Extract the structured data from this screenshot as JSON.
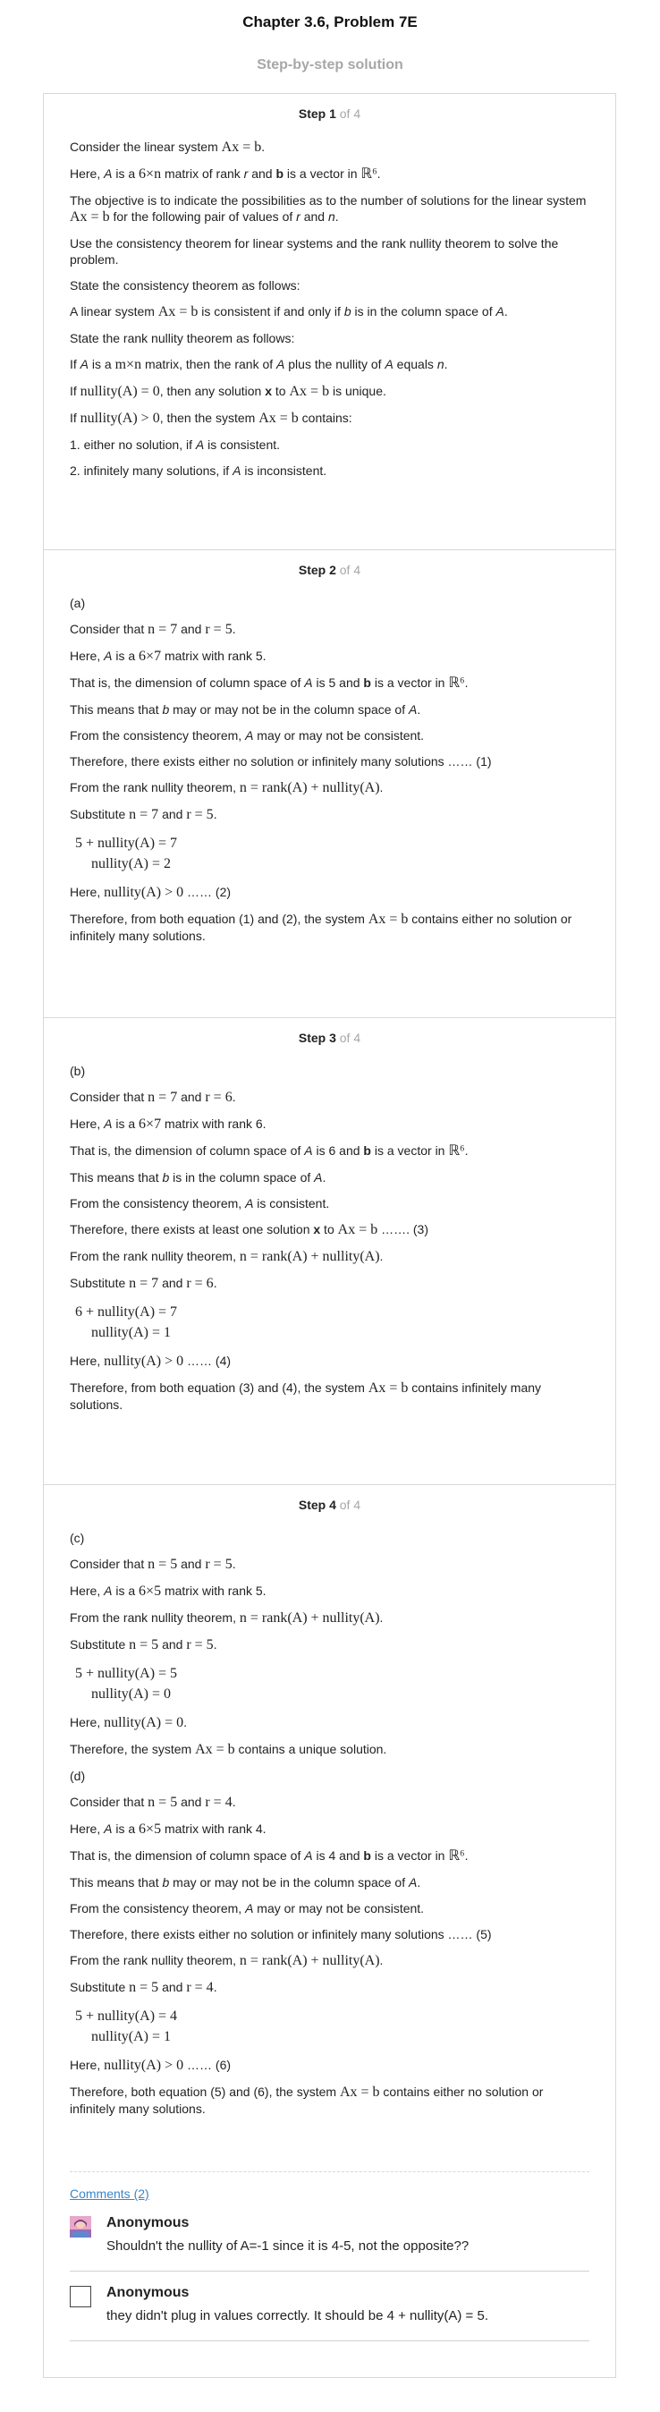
{
  "header": {
    "title": "Chapter 3.6, Problem 7E",
    "subtitle": "Step-by-step solution"
  },
  "steps": [
    {
      "label": "Step 1",
      "of": "of 4",
      "lines": [
        [
          {
            "t": "Consider the linear system "
          },
          {
            "m": "Ax = b"
          },
          {
            "t": "."
          }
        ],
        [
          {
            "t": "Here, "
          },
          {
            "i": "A"
          },
          {
            "t": " is a "
          },
          {
            "m": "6×n"
          },
          {
            "t": " matrix of rank "
          },
          {
            "i": "r"
          },
          {
            "t": " and "
          },
          {
            "b": "b"
          },
          {
            "t": " is a vector in "
          },
          {
            "m": "ℝ⁶"
          },
          {
            "t": "."
          }
        ],
        [
          {
            "t": "The objective is to indicate the possibilities as to the number of solutions for the linear system "
          },
          {
            "m": "Ax = b"
          },
          {
            "t": " for the following pair of values of "
          },
          {
            "i": "r"
          },
          {
            "t": " and "
          },
          {
            "i": "n"
          },
          {
            "t": "."
          }
        ],
        [
          {
            "t": "Use the consistency theorem for linear systems and the rank nullity theorem to solve the problem."
          }
        ],
        [
          {
            "t": "State the consistency theorem as follows:"
          }
        ],
        [
          {
            "t": "A linear system "
          },
          {
            "m": "Ax = b"
          },
          {
            "t": " is consistent if and only if "
          },
          {
            "i": "b"
          },
          {
            "t": " is in the column space of "
          },
          {
            "i": "A"
          },
          {
            "t": "."
          }
        ],
        [
          {
            "t": "State the rank nullity theorem as follows:"
          }
        ],
        [
          {
            "t": "If "
          },
          {
            "i": "A"
          },
          {
            "t": " is a "
          },
          {
            "m": "m×n"
          },
          {
            "t": " matrix, then the rank of "
          },
          {
            "i": "A"
          },
          {
            "t": " plus the nullity of "
          },
          {
            "i": "A"
          },
          {
            "t": " equals "
          },
          {
            "i": "n"
          },
          {
            "t": "."
          }
        ],
        [
          {
            "t": "If "
          },
          {
            "m": "nullity(A) = 0"
          },
          {
            "t": ", then any solution "
          },
          {
            "b": "x"
          },
          {
            "t": " to "
          },
          {
            "m": "Ax = b"
          },
          {
            "t": " is unique."
          }
        ],
        [
          {
            "t": "If "
          },
          {
            "m": "nullity(A) > 0"
          },
          {
            "t": ", then the system "
          },
          {
            "m": "Ax = b"
          },
          {
            "t": " contains:"
          }
        ],
        [
          {
            "t": "1. either no solution, if "
          },
          {
            "i": "A"
          },
          {
            "t": " is consistent."
          }
        ],
        [
          {
            "t": "2. infinitely many solutions, if "
          },
          {
            "i": "A"
          },
          {
            "t": " is inconsistent."
          }
        ]
      ]
    },
    {
      "label": "Step 2",
      "of": "of 4",
      "lines": [
        [
          {
            "t": "(a)"
          }
        ],
        [
          {
            "t": "Consider that "
          },
          {
            "m": "n = 7"
          },
          {
            "t": " and "
          },
          {
            "m": "r = 5"
          },
          {
            "t": "."
          }
        ],
        [
          {
            "t": "Here, "
          },
          {
            "i": "A"
          },
          {
            "t": " is a "
          },
          {
            "m": "6×7"
          },
          {
            "t": " matrix with rank 5."
          }
        ],
        [
          {
            "t": "That is, the dimension of column space of "
          },
          {
            "i": "A"
          },
          {
            "t": " is 5 and "
          },
          {
            "b": "b"
          },
          {
            "t": " is a vector in "
          },
          {
            "m": "ℝ⁶"
          },
          {
            "t": "."
          }
        ],
        [
          {
            "t": "This means that "
          },
          {
            "i": "b"
          },
          {
            "t": " may or may not be in the column space of "
          },
          {
            "i": "A"
          },
          {
            "t": "."
          }
        ],
        [
          {
            "t": "From the consistency theorem, "
          },
          {
            "i": "A"
          },
          {
            "t": " may or may not be consistent."
          }
        ],
        [
          {
            "t": "Therefore, there exists either no solution or infinitely many solutions …… (1)"
          }
        ],
        [
          {
            "t": "From the rank nullity theorem, "
          },
          {
            "m": "n = rank(A) + nullity(A)"
          },
          {
            "t": "."
          }
        ],
        [
          {
            "t": "Substitute "
          },
          {
            "m": "n = 7"
          },
          {
            "t": " and "
          },
          {
            "m": "r = 5"
          },
          {
            "t": "."
          }
        ],
        {
          "eq": [
            "5 + nullity(A) = 7",
            "nullity(A) = 2"
          ]
        },
        [
          {
            "t": "Here, "
          },
          {
            "m": "nullity(A) > 0"
          },
          {
            "t": " …… (2)"
          }
        ],
        [
          {
            "t": "Therefore, from both equation (1) and (2), the system "
          },
          {
            "m": "Ax = b"
          },
          {
            "t": " contains either no solution or infinitely many solutions."
          }
        ]
      ]
    },
    {
      "label": "Step 3",
      "of": "of 4",
      "lines": [
        [
          {
            "t": "(b)"
          }
        ],
        [
          {
            "t": "Consider that "
          },
          {
            "m": "n = 7"
          },
          {
            "t": " and "
          },
          {
            "m": "r = 6"
          },
          {
            "t": "."
          }
        ],
        [
          {
            "t": "Here, "
          },
          {
            "i": "A"
          },
          {
            "t": " is a "
          },
          {
            "m": "6×7"
          },
          {
            "t": " matrix with rank 6."
          }
        ],
        [
          {
            "t": "That is, the dimension of column space of "
          },
          {
            "i": "A"
          },
          {
            "t": " is 6 and "
          },
          {
            "b": "b"
          },
          {
            "t": " is a vector in "
          },
          {
            "m": "ℝ⁶"
          },
          {
            "t": "."
          }
        ],
        [
          {
            "t": "This means that "
          },
          {
            "i": "b"
          },
          {
            "t": " is in the column space of "
          },
          {
            "i": "A"
          },
          {
            "t": "."
          }
        ],
        [
          {
            "t": "From the consistency theorem, "
          },
          {
            "i": "A"
          },
          {
            "t": " is consistent."
          }
        ],
        [
          {
            "t": "Therefore, there exists at least one solution "
          },
          {
            "b": "x"
          },
          {
            "t": " to "
          },
          {
            "m": "Ax = b"
          },
          {
            "t": " ……. (3)"
          }
        ],
        [
          {
            "t": "From the rank nullity theorem, "
          },
          {
            "m": "n = rank(A) + nullity(A)"
          },
          {
            "t": "."
          }
        ],
        [
          {
            "t": "Substitute "
          },
          {
            "m": "n = 7"
          },
          {
            "t": " and "
          },
          {
            "m": "r = 6"
          },
          {
            "t": "."
          }
        ],
        {
          "eq": [
            "6 + nullity(A) = 7",
            "nullity(A) = 1"
          ]
        },
        [
          {
            "t": "Here, "
          },
          {
            "m": "nullity(A) > 0"
          },
          {
            "t": " …… (4)"
          }
        ],
        [
          {
            "t": "Therefore, from both equation (3) and (4), the system "
          },
          {
            "m": "Ax = b"
          },
          {
            "t": " contains infinitely many solutions."
          }
        ]
      ]
    },
    {
      "label": "Step 4",
      "of": "of 4",
      "lines": [
        [
          {
            "t": "(c)"
          }
        ],
        [
          {
            "t": "Consider that "
          },
          {
            "m": "n = 5"
          },
          {
            "t": " and "
          },
          {
            "m": "r = 5"
          },
          {
            "t": "."
          }
        ],
        [
          {
            "t": "Here, "
          },
          {
            "i": "A"
          },
          {
            "t": " is a "
          },
          {
            "m": "6×5"
          },
          {
            "t": " matrix with rank 5."
          }
        ],
        [
          {
            "t": "From the rank nullity theorem, "
          },
          {
            "m": "n = rank(A) + nullity(A)"
          },
          {
            "t": "."
          }
        ],
        [
          {
            "t": "Substitute "
          },
          {
            "m": "n = 5"
          },
          {
            "t": " and "
          },
          {
            "m": "r = 5"
          },
          {
            "t": "."
          }
        ],
        {
          "eq": [
            "5 + nullity(A) = 5",
            "nullity(A) = 0"
          ]
        },
        [
          {
            "t": "Here, "
          },
          {
            "m": "nullity(A) = 0"
          },
          {
            "t": "."
          }
        ],
        [
          {
            "t": "Therefore, the system "
          },
          {
            "m": "Ax = b"
          },
          {
            "t": " contains a unique solution."
          }
        ],
        [
          {
            "t": "(d)"
          }
        ],
        [
          {
            "t": "Consider that "
          },
          {
            "m": "n = 5"
          },
          {
            "t": " and "
          },
          {
            "m": "r = 4"
          },
          {
            "t": "."
          }
        ],
        [
          {
            "t": "Here, "
          },
          {
            "i": "A"
          },
          {
            "t": " is a "
          },
          {
            "m": "6×5"
          },
          {
            "t": " matrix with rank 4."
          }
        ],
        [
          {
            "t": "That is, the dimension of column space of "
          },
          {
            "i": "A"
          },
          {
            "t": " is 4 and "
          },
          {
            "b": "b"
          },
          {
            "t": " is a vector in "
          },
          {
            "m": "ℝ⁶"
          },
          {
            "t": "."
          }
        ],
        [
          {
            "t": "This means that "
          },
          {
            "i": "b"
          },
          {
            "t": " may or may not be in the column space of "
          },
          {
            "i": "A"
          },
          {
            "t": "."
          }
        ],
        [
          {
            "t": "From the consistency theorem, "
          },
          {
            "i": "A"
          },
          {
            "t": " may or may not be consistent."
          }
        ],
        [
          {
            "t": "Therefore, there exists either no solution or infinitely many solutions …… (5)"
          }
        ],
        [
          {
            "t": "From the rank nullity theorem, "
          },
          {
            "m": "n = rank(A) + nullity(A)"
          },
          {
            "t": "."
          }
        ],
        [
          {
            "t": "Substitute "
          },
          {
            "m": "n = 5"
          },
          {
            "t": " and "
          },
          {
            "m": "r = 4"
          },
          {
            "t": "."
          }
        ],
        {
          "eq": [
            "5 + nullity(A) = 4",
            "nullity(A) = 1"
          ]
        },
        [
          {
            "t": "Here, "
          },
          {
            "m": "nullity(A) > 0"
          },
          {
            "t": " …… (6)"
          }
        ],
        [
          {
            "t": "Therefore, both equation (5) and (6), the system "
          },
          {
            "m": "Ax = b"
          },
          {
            "t": " contains either no solution or infinitely many solutions."
          }
        ]
      ]
    }
  ],
  "comments": {
    "link_label": "Comments (2)",
    "items": [
      {
        "author": "Anonymous",
        "text": "Shouldn't the nullity of A=-1 since it is 4-5, not the opposite??",
        "avatar": "avatar-image-icon"
      },
      {
        "author": "Anonymous",
        "text": "they didn't plug in values correctly. It should be 4 + nullity(A) = 5.",
        "avatar": "avatar-placeholder-icon"
      }
    ]
  },
  "colors": {
    "muted_text": "#a7a7a7",
    "link": "#3a86c8",
    "border": "#d8d8d8"
  }
}
